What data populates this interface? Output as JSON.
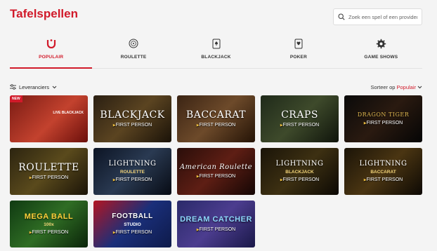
{
  "page": {
    "title": "Tafelspellen"
  },
  "search": {
    "placeholder": "Zoek een spel of een provider"
  },
  "tabs": [
    {
      "label": "POPULAIR",
      "icon": "popular-icon",
      "active": true
    },
    {
      "label": "ROULETTE",
      "icon": "roulette-icon",
      "active": false
    },
    {
      "label": "BLACKJACK",
      "icon": "blackjack-card-icon",
      "active": false
    },
    {
      "label": "POKER",
      "icon": "poker-card-icon",
      "active": false
    },
    {
      "label": "GAME SHOWS",
      "icon": "game-shows-icon",
      "active": false
    }
  ],
  "toolbar": {
    "filter_label": "Leveranciers",
    "sort_prefix": "Sorteer op",
    "sort_value": "Populair"
  },
  "colors": {
    "accent": "#d11a2a",
    "background": "#f4f4f4"
  },
  "games": [
    {
      "name": "",
      "badge": "NEW",
      "live_label": "LIVE BLACKJACK",
      "provider": "",
      "bg": "linear-gradient(135deg,#7a1b14,#c3422e 55%,#6b0f0b)"
    },
    {
      "name": "BLACKJACK",
      "provider": "FIRST PERSON",
      "bg": "linear-gradient(135deg,#2a1f12,#5b4421 50%,#1a1208)"
    },
    {
      "name": "BACCARAT",
      "provider": "FIRST PERSON",
      "bg": "linear-gradient(135deg,#3b2414,#6d4a2a 50%,#241306)"
    },
    {
      "name": "CRAPS",
      "provider": "FIRST PERSON",
      "bg": "linear-gradient(135deg,#1f2a1a,#3e4a2b 50%,#0f140b)"
    },
    {
      "name": "DRAGON TIGER",
      "provider": "FIRST PERSON",
      "bg": "linear-gradient(135deg,#0a0a0a,#2a1a10 50%,#050505)"
    },
    {
      "name": "ROULETTE",
      "provider": "FIRST PERSON",
      "bg": "linear-gradient(135deg,#2c2410,#5a4a1c 50%,#1b1408)"
    },
    {
      "name": "LIGHTNING",
      "subtitle": "ROULETTE",
      "provider": "FIRST PERSON",
      "bg": "linear-gradient(135deg,#0c1424,#2a3a52 50%,#070b14)"
    },
    {
      "name": "American Roulette",
      "provider": "FIRST PERSON",
      "bg": "linear-gradient(135deg,#2a0e0a,#5e1e14 50%,#140604)"
    },
    {
      "name": "LIGHTNING",
      "subtitle": "BLACKJACK",
      "provider": "FIRST PERSON",
      "bg": "linear-gradient(135deg,#1a1408,#3d3012 50%,#0c0904)"
    },
    {
      "name": "LIGHTNING",
      "subtitle": "BACCARAT",
      "provider": "FIRST PERSON",
      "bg": "linear-gradient(135deg,#1b1408,#4a3512 50%,#0d0904)"
    },
    {
      "name": "MEGA BALL",
      "subtitle": "100x",
      "provider": "FIRST PERSON",
      "bg": "linear-gradient(135deg,#103a12,#2f6d24 50%,#0a2309)"
    },
    {
      "name": "FOOTBALL",
      "subtitle": "STUDIO",
      "provider": "FIRST PERSON",
      "bg": "linear-gradient(135deg,#b31521,#1a2f7a 50%,#0e1a4a)"
    },
    {
      "name": "DREAM CATCHER",
      "provider": "FIRST PERSON",
      "bg": "linear-gradient(135deg,#2a2a6a,#4c3d8f 50%,#1a1848)"
    }
  ]
}
